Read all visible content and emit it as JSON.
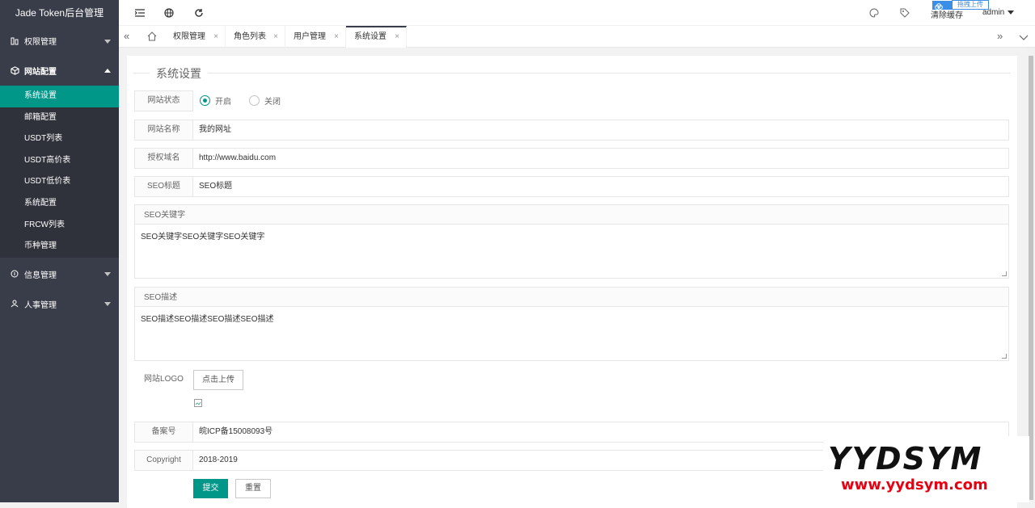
{
  "app_title": "Jade Token后台管理",
  "sidebar": {
    "groups": [
      {
        "label": "权限管理"
      },
      {
        "label": "网站配置"
      },
      {
        "label": "信息管理"
      },
      {
        "label": "人事管理"
      }
    ],
    "subitems": [
      "系统设置",
      "邮箱配置",
      "USDT列表",
      "USDT高价表",
      "USDT低价表",
      "系统配置",
      "FRCW列表",
      "币种管理"
    ]
  },
  "header": {
    "clear_cache": "清除缓存",
    "user": "admin",
    "upload_badge": "拖拽上传"
  },
  "tabs": [
    "权限管理",
    "角色列表",
    "用户管理",
    "系统设置"
  ],
  "form": {
    "legend": "系统设置",
    "status_label": "网站状态",
    "status_on": "开启",
    "status_off": "关闭",
    "name_label": "网站名称",
    "name_value": "我的网址",
    "domain_label": "授权域名",
    "domain_value": "http://www.baidu.com",
    "seo_title_label": "SEO标题",
    "seo_title_value": "SEO标题",
    "seo_kw_label": "SEO关键字",
    "seo_kw_value": "SEO关键字SEO关键字SEO关键字",
    "seo_desc_label": "SEO描述",
    "seo_desc_value": "SEO描述SEO描述SEO描述SEO描述",
    "logo_label": "网站LOGO",
    "upload_btn": "点击上传",
    "icp_label": "备案号",
    "icp_value": "皖ICP备15008093号",
    "copyright_label": "Copyright",
    "copyright_value": "2018-2019",
    "submit": "提交",
    "reset": "重置"
  },
  "watermark": {
    "brand": "YYDSYM",
    "url": "www.yydsym.com"
  },
  "colors": {
    "sidebar": "#393d49",
    "active": "#009688",
    "submenu": "#2f323b"
  }
}
